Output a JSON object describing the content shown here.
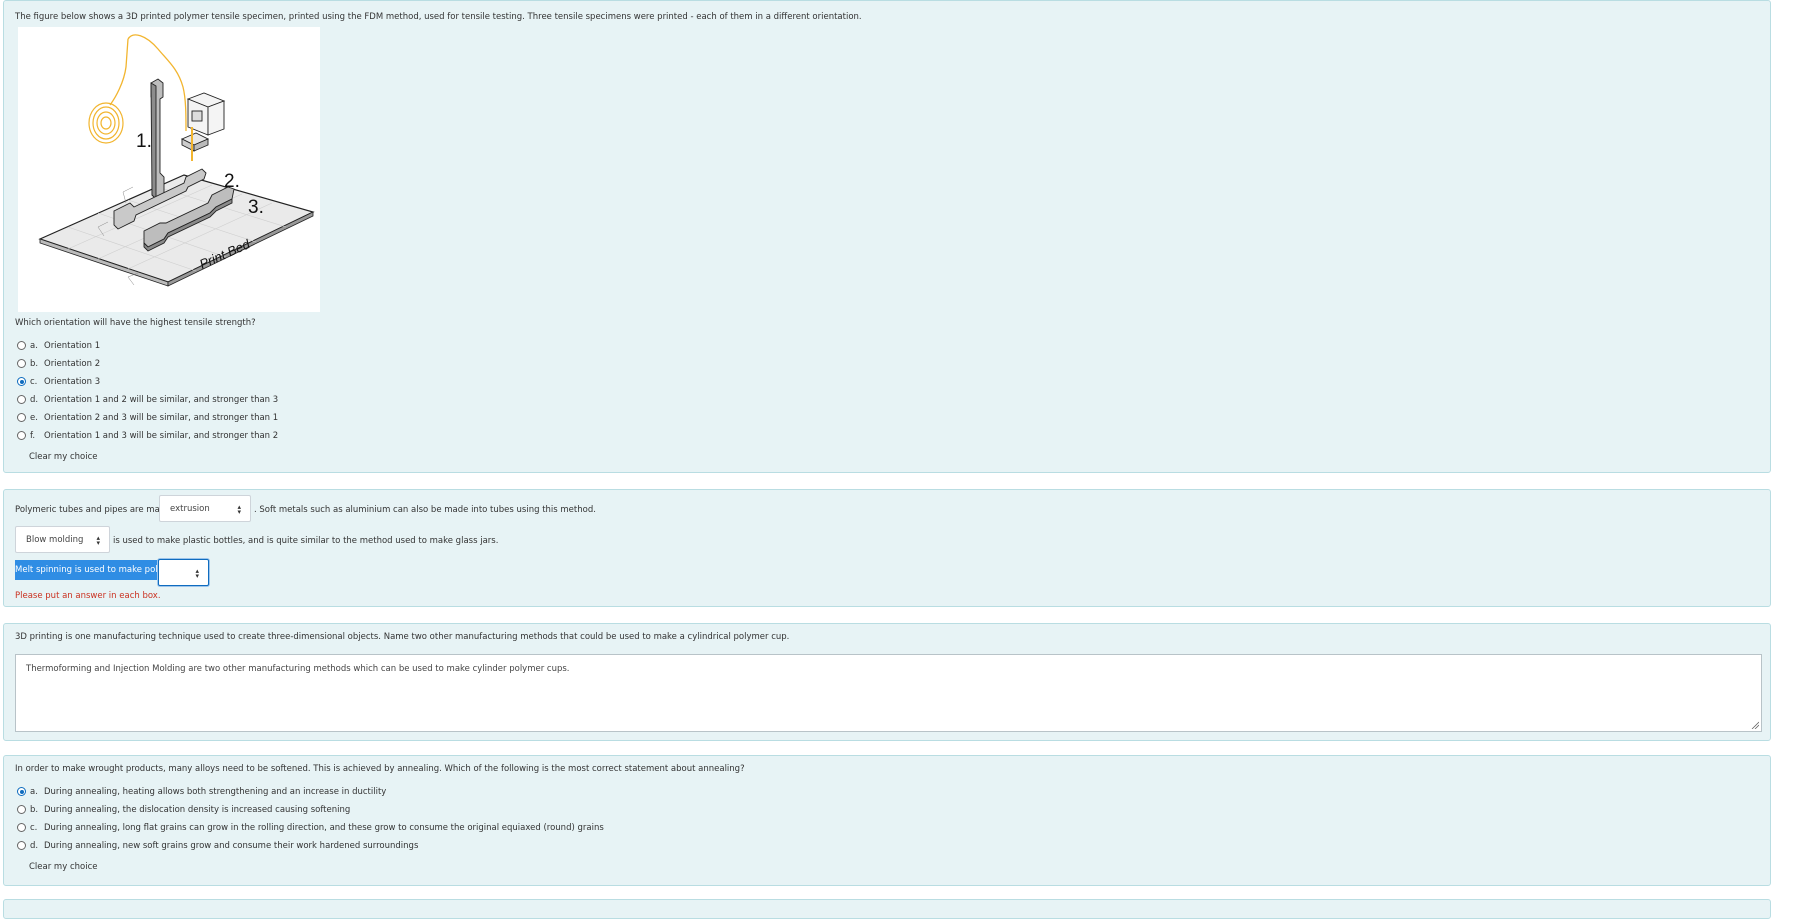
{
  "q1": {
    "intro": "The figure below shows a 3D printed polymer tensile specimen, printed using the FDM method, used for tensile testing. Three tensile specimens were printed - each of them in a different orientation.",
    "figure_labels": [
      "1.",
      "2.",
      "3.",
      "Print Bed"
    ],
    "question": "Which orientation will have the highest tensile strength?",
    "options": [
      {
        "letter": "a.",
        "text": "Orientation 1"
      },
      {
        "letter": "b.",
        "text": "Orientation 2"
      },
      {
        "letter": "c.",
        "text": "Orientation 3"
      },
      {
        "letter": "d.",
        "text": "Orientation 1 and 2 will be similar, and stronger than 3"
      },
      {
        "letter": "e.",
        "text": "Orientation 2 and 3 will be similar, and stronger than 1"
      },
      {
        "letter": "f.",
        "text": "Orientation 1 and 3 will be similar, and stronger than 2"
      }
    ],
    "selected": "c.",
    "clear": "Clear my choice"
  },
  "q2": {
    "line1_before": "Polymeric tubes and pipes are made by",
    "select1": "extrusion",
    "line1_after": ". Soft metals such as aluminium can also be made into tubes using this method.",
    "select2": "Blow molding",
    "line2_after": "is used to make plastic bottles, and is quite similar to the method used to make glass jars.",
    "line3_highlight": "Melt spinning is used to make polymer",
    "select3": "",
    "error": "Please put an answer in each box."
  },
  "q3": {
    "question": "3D printing is one manufacturing technique used to create three-dimensional objects.  Name two other manufacturing methods that could be used to make a cylindrical polymer cup.",
    "answer": "Thermoforming and Injection Molding are two other manufacturing methods which can be used to make cylinder polymer cups."
  },
  "q4": {
    "question": "In order to make wrought products, many alloys need to be softened. This is achieved by annealing. Which of the following is the most correct statement about annealing?",
    "options": [
      {
        "letter": "a.",
        "text": "During annealing, heating allows both strengthening and an increase in ductility"
      },
      {
        "letter": "b.",
        "text": "During annealing, the dislocation density is increased causing softening"
      },
      {
        "letter": "c.",
        "text": "During annealing, long flat grains can grow in the rolling direction, and these grow to consume the original equiaxed (round) grains"
      },
      {
        "letter": "d.",
        "text": "During annealing, new soft grains grow and consume their work hardened surroundings"
      }
    ],
    "selected": "a.",
    "clear": "Clear my choice"
  },
  "colors": {
    "panel_bg": "#e7f3f5",
    "panel_border": "#b9dde2",
    "accent": "#0f6cbf",
    "highlight": "#2f8de4",
    "error": "#ca3120",
    "filament": "#f2b52f"
  },
  "icons": [
    "radio-icon",
    "select-caret-icon",
    "resize-handle-icon",
    "filament-spool-icon",
    "print-head-icon"
  ]
}
